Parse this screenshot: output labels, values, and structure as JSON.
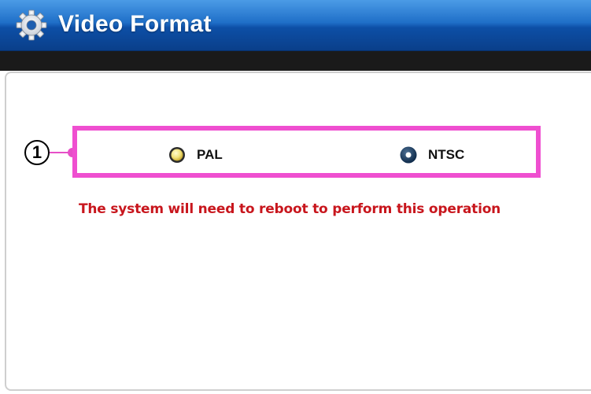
{
  "header": {
    "title": "Video Format",
    "icon": "gear-icon",
    "colors": {
      "bar_top": "#4b9be6",
      "bar_bottom": "#0a3f8a",
      "title_text": "#ffffff"
    }
  },
  "annotation": {
    "callout_number": "1",
    "highlight_color": "#ef4fd0"
  },
  "video_format": {
    "options": [
      {
        "label": "PAL",
        "selected": false,
        "icon": "radio-unselected-icon"
      },
      {
        "label": "NTSC",
        "selected": true,
        "icon": "radio-selected-icon"
      }
    ],
    "selected_value": "NTSC"
  },
  "message": {
    "text": "The system will need to reboot to perform this operation",
    "color": "#c8161d"
  }
}
